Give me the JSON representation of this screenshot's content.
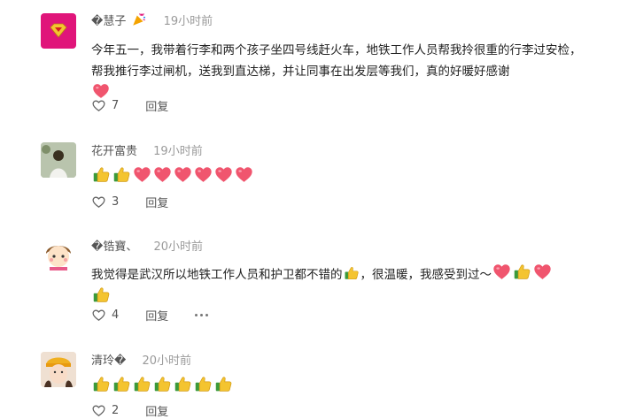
{
  "comments": [
    {
      "username": "�慧子",
      "badge_icon": "party-popper-icon",
      "time": "19小时前",
      "text": "今年五一，我带着行李和两个孩子坐四号线赶火车，地铁工作人员帮我拎很重的行李过安检，帮我推行李过闸机，送我到直达梯，并让同事在出发层等我们，真的好暖好感谢",
      "emojis": [
        "heart"
      ],
      "likes": "7",
      "reply_label": "回复"
    },
    {
      "username": "花开富贵",
      "time": "19小时前",
      "text": "",
      "emojis": [
        "thumbs-up",
        "thumbs-up",
        "heart",
        "heart",
        "heart",
        "heart",
        "heart",
        "heart"
      ],
      "likes": "3",
      "reply_label": "回复"
    },
    {
      "username": "�锆寶、",
      "time": "20小时前",
      "text_before": "我觉得是武汉所以地铁工作人员和护卫都不错的",
      "text_after": "，很温暖，我感受到过～",
      "emojis_end": [
        "heart",
        "thumbs-up",
        "heart",
        "thumbs-up"
      ],
      "likes": "4",
      "reply_label": "回复",
      "more_icon": "more-icon"
    },
    {
      "username": "清玲�",
      "time": "20小时前",
      "text": "",
      "emojis": [
        "thumbs-up",
        "thumbs-up",
        "thumbs-up",
        "thumbs-up",
        "thumbs-up",
        "thumbs-up",
        "thumbs-up"
      ],
      "likes": "2",
      "reply_label": "回复"
    }
  ],
  "colors": {
    "heart": "#f0556e",
    "thumb": "#f4c430",
    "sleeve": "#3b9a3b",
    "time": "#9a9a9a"
  }
}
